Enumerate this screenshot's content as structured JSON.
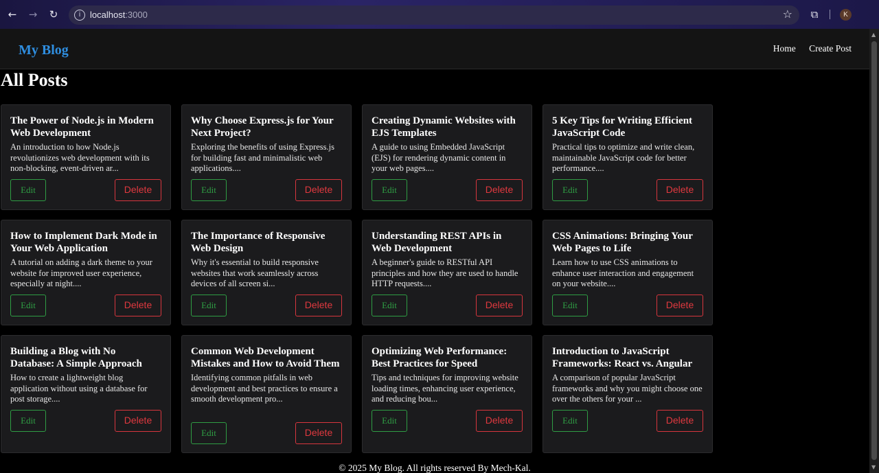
{
  "browser": {
    "url_host": "localhost",
    "url_port": ":3000",
    "profile_initial": "K"
  },
  "header": {
    "logo": "My Blog",
    "nav": [
      "Home",
      "Create Post"
    ]
  },
  "main": {
    "title": "All Posts",
    "edit_label": "Edit",
    "delete_label": "Delete",
    "posts": [
      {
        "title": "The Power of Node.js in Modern Web Development",
        "excerpt": "An introduction to how Node.js revolutionizes web development with its non-blocking, event-driven ar..."
      },
      {
        "title": "Why Choose Express.js for Your Next Project?",
        "excerpt": "Exploring the benefits of using Express.js for building fast and minimalistic web applications...."
      },
      {
        "title": "Creating Dynamic Websites with EJS Templates",
        "excerpt": "A guide to using Embedded JavaScript (EJS) for rendering dynamic content in your web pages...."
      },
      {
        "title": "5 Key Tips for Writing Efficient JavaScript Code",
        "excerpt": "Practical tips to optimize and write clean, maintainable JavaScript code for better performance...."
      },
      {
        "title": "How to Implement Dark Mode in Your Web Application",
        "excerpt": "A tutorial on adding a dark theme to your website for improved user experience, especially at night...."
      },
      {
        "title": "The Importance of Responsive Web Design",
        "excerpt": "Why it's essential to build responsive websites that work seamlessly across devices of all screen si..."
      },
      {
        "title": "Understanding REST APIs in Web Development",
        "excerpt": "A beginner's guide to RESTful API principles and how they are used to handle HTTP requests...."
      },
      {
        "title": "CSS Animations: Bringing Your Web Pages to Life",
        "excerpt": "Learn how to use CSS animations to enhance user interaction and engagement on your website...."
      },
      {
        "title": "Building a Blog with No Database: A Simple Approach",
        "excerpt": "How to create a lightweight blog application without using a database for post storage...."
      },
      {
        "title": "Common Web Development Mistakes and How to Avoid Them",
        "excerpt": "Identifying common pitfalls in web development and best practices to ensure a smooth development pro..."
      },
      {
        "title": "Optimizing Web Performance: Best Practices for Speed",
        "excerpt": "Tips and techniques for improving website loading times, enhancing user experience, and reducing bou..."
      },
      {
        "title": "Introduction to JavaScript Frameworks: React vs. Angular",
        "excerpt": "A comparison of popular JavaScript frameworks and why you might choose one over the others for your ..."
      }
    ]
  },
  "footer": {
    "text": "© 2025 My Blog. All rights reserved By Mech-Kal."
  },
  "colors": {
    "logo": "#2f8ee0",
    "edit": "#2f9e44",
    "delete": "#e0393f",
    "card_bg": "#1b1b1d"
  }
}
